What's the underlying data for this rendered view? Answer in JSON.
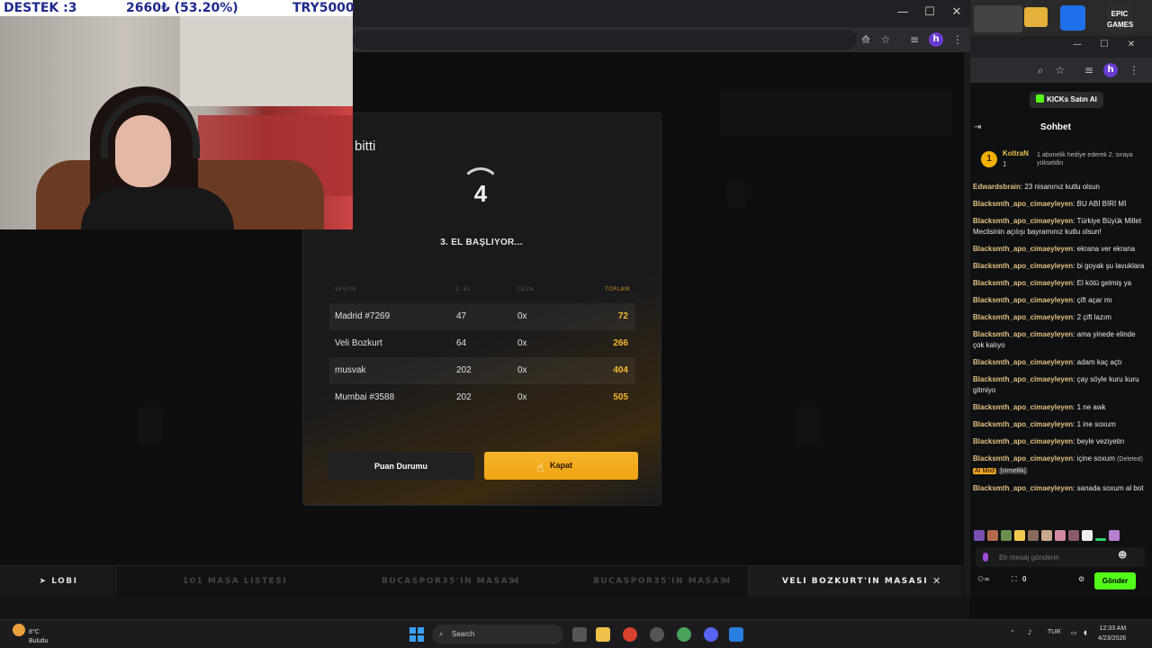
{
  "ticker": {
    "destek": "DESTEK :3",
    "amount": "2660₺ (53.20%)",
    "goal": "TRY5000"
  },
  "modal": {
    "title": "bitti",
    "countdown": "4",
    "status": "3. EL BAŞLIYOR...",
    "headers": [
      "SEVIYE",
      "2. EL",
      "CEZA",
      "TOPLAM"
    ],
    "rows": [
      {
        "name": "Madrid #7269",
        "el": "47",
        "ceza": "0x",
        "total": "72"
      },
      {
        "name": "Veli Bozkurt",
        "el": "64",
        "ceza": "0x",
        "total": "266"
      },
      {
        "name": "musvak",
        "el": "202",
        "ceza": "0x",
        "total": "404"
      },
      {
        "name": "Mumbai #3588",
        "el": "202",
        "ceza": "0x",
        "total": "505"
      }
    ],
    "btn_score": "Puan Durumu",
    "btn_close": "Kapat"
  },
  "game_nav": {
    "lobi": "LOBI",
    "tab1": "101 MASA LISTESI",
    "tab2": "BUCASPOR35'IN MASASI",
    "tab3": "BUCASPOR35'IN MASASI",
    "active": "VELI BOZKURT'IN MASASI"
  },
  "chat": {
    "kick_btn": "KICKs Satın Al",
    "title": "Sohbet",
    "pinned": {
      "badge": "1",
      "name": "KoltraN",
      "sub": "1",
      "note": "1 abonelik hediye ederek 2. sıraya yükseldin"
    },
    "messages": [
      {
        "user": "Edwardsbrain",
        "text": "23 nisanınız kutlu olsun"
      },
      {
        "user": "Blacksmth_apo_cimaeyleyen",
        "text": "BU ABİ BİRİ Mİ"
      },
      {
        "user": "Blacksmth_apo_cimaeyleyen",
        "text": "Türkiye Büyük Millet Meclisinin açılışı bayramınız kutlu olsun!"
      },
      {
        "user": "Blacksmth_apo_cimaeyleyen",
        "text": "ekrana ver ekrana"
      },
      {
        "user": "Blacksmth_apo_cimaeyleyen",
        "text": "bi goyak şu lavuklara"
      },
      {
        "user": "Blacksmth_apo_cimaeyleyen",
        "text": "El kötü gelmiş ya"
      },
      {
        "user": "Blacksmth_apo_cimaeyleyen",
        "text": "çift açar mı"
      },
      {
        "user": "Blacksmth_apo_cimaeyleyen",
        "text": "2 çift lazım"
      },
      {
        "user": "Blacksmth_apo_cimaeyleyen",
        "text": "ama yinede elinde çok kalıyo"
      },
      {
        "user": "Blacksmth_apo_cimaeyleyen",
        "text": "adam kaç açtı"
      },
      {
        "user": "Blacksmth_apo_cimaeyleyen",
        "text": "çay söyle kuru kuru gitmiyo"
      },
      {
        "user": "Blacksmth_apo_cimaeyleyen",
        "text": "1 ne awk"
      },
      {
        "user": "Blacksmth_apo_cimaeyleyen",
        "text": "1 ine soxum"
      },
      {
        "user": "Blacksmth_apo_cimaeyleyen",
        "text": "beyle veziyetin"
      }
    ],
    "deleted_msg": {
      "user": "Blacksmth_apo_cimaeyleyen",
      "text": "içine soxum",
      "deleted": "(Deleted)",
      "ai": "AI Mod",
      "cat": "[cinsellik]"
    },
    "last_msg": {
      "user": "Blacksmth_apo_cimaeyleyen",
      "text": "sanada soxum al bot"
    },
    "input_placeholder": "Bir mesaj gönderin",
    "coins": "0",
    "send": "Gönder"
  },
  "taskbar": {
    "temp": "8°C",
    "weather": "Bulutlu",
    "search": "Search",
    "lang": "TUR",
    "time": "12:33 AM",
    "date": "4/23/2026"
  },
  "icons": {
    "spinner": "spinner-icon",
    "close": "close-icon",
    "send": "paper-plane-icon"
  },
  "colors": {
    "accent_gold": "#f0a314",
    "kick_green": "#53fc18",
    "total_gold": "#f5b731"
  }
}
